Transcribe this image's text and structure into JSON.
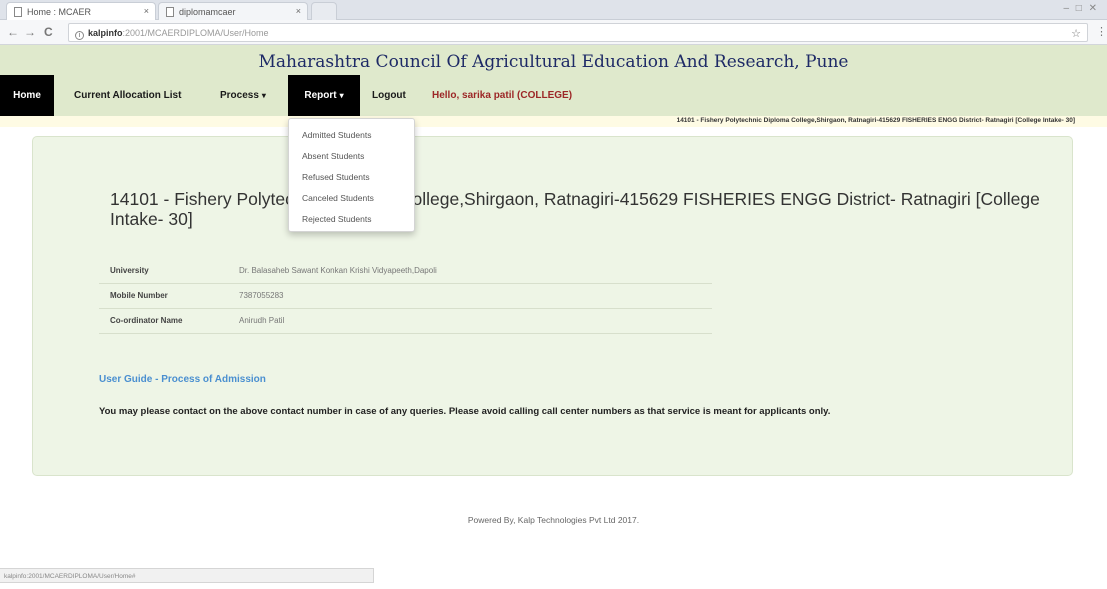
{
  "browser": {
    "tabs": [
      {
        "title": "Home : MCAER"
      },
      {
        "title": "diplomamcaer"
      }
    ],
    "tab_close_glyph": "×",
    "new_tab_glyph": "",
    "window_controls": "– □ ✕",
    "back_glyph": "←",
    "forward_glyph": "→",
    "reload_glyph": "C",
    "url_host": "kalpinfo",
    "url_path": ":2001/MCAERDIPLOMA/User/Home",
    "star_glyph": "☆",
    "menu_glyph": "⋮",
    "status_url": "kalpinfo:2001/MCAERDIPLOMA/User/Home#"
  },
  "site": {
    "title": "Maharashtra Council Of Agricultural Education And Research, Pune"
  },
  "nav": {
    "home": "Home",
    "allocation": "Current Allocation List",
    "process": "Process",
    "report": "Report",
    "logout": "Logout",
    "greeting": "Hello, sarika patil  (COLLEGE)",
    "caret": "▾"
  },
  "college_strip": "14101 - Fishery Polytechnic Diploma College,Shirgaon, Ratnagiri-415629 FISHERIES ENGG District- Ratnagiri [College Intake- 30]",
  "main": {
    "heading": "14101 - Fishery Polytechnic Diploma College,Shirgaon, Ratnagiri-415629 FISHERIES ENGG District- Ratnagiri [College Intake- 30]",
    "info": [
      {
        "label": "University",
        "value": "Dr. Balasaheb Sawant Konkan Krishi Vidyapeeth,Dapoli"
      },
      {
        "label": "Mobile Number",
        "value": "7387055283"
      },
      {
        "label": "Co-ordinator Name",
        "value": "Anirudh Patil"
      }
    ],
    "guide_link": "User Guide - Process of Admission",
    "notice": "You may please contact on the above contact number in case of any queries. Please avoid calling call center numbers as that service is meant for applicants only."
  },
  "report_menu": [
    "Admitted Students",
    "Absent Students",
    "Refused Students",
    "Canceled Students",
    "Rejected Students"
  ],
  "footer": "Powered By, Kalp Technologies Pvt Ltd 2017."
}
